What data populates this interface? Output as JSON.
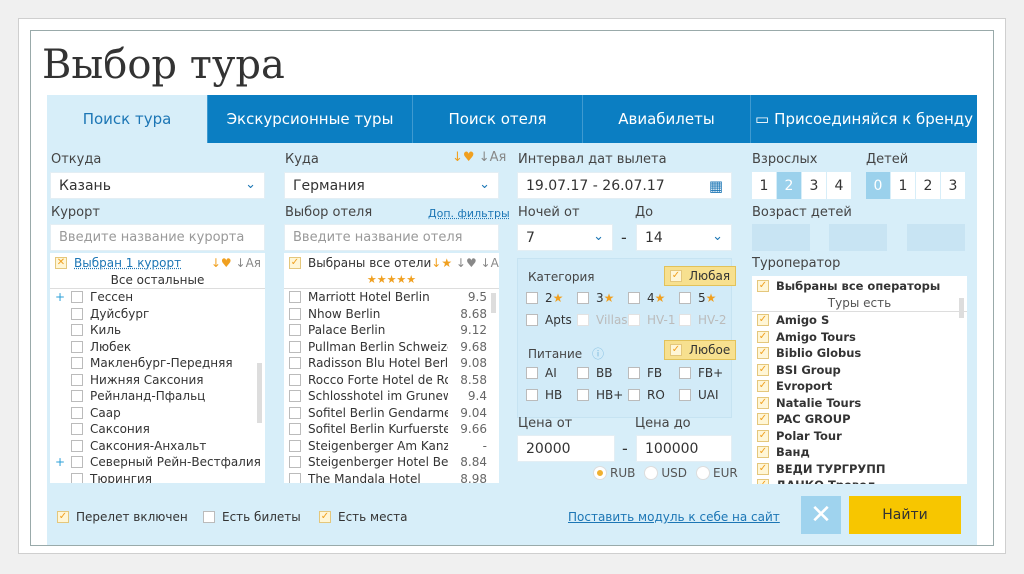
{
  "title": "Выбор тура",
  "tabs": [
    "Поиск тура",
    "Экскурсионные туры",
    "Поиск отеля",
    "Авиабилеты",
    "Присоединяйся к бренду"
  ],
  "from": {
    "label": "Откуда",
    "value": "Казань"
  },
  "to": {
    "label": "Куда",
    "value": "Германия"
  },
  "resort": {
    "label": "Курорт",
    "placeholder": "Введите название курорта",
    "selected": "Выбран 1 курорт",
    "group": "Все остальные",
    "items": [
      {
        "name": "Гессен",
        "expand": true
      },
      {
        "name": "Дуйсбург"
      },
      {
        "name": "Киль"
      },
      {
        "name": "Любек"
      },
      {
        "name": "Макленбург-Передняя"
      },
      {
        "name": "Нижняя Саксония"
      },
      {
        "name": "Рейнланд-Пфальц"
      },
      {
        "name": "Саар"
      },
      {
        "name": "Саксония"
      },
      {
        "name": "Саксония-Анхальт"
      },
      {
        "name": "Северный Рейн-Вестфалия",
        "expand": true
      },
      {
        "name": "Тюрингия"
      }
    ]
  },
  "sort_alpha": "↓Ая",
  "hotel": {
    "label": "Выбор отеля",
    "filters_link": "Доп. фильтры",
    "placeholder": "Введите название отеля",
    "selected": "Выбраны все отели",
    "stars": "★★★★★",
    "items": [
      {
        "name": "Marriott Hotel Berlin",
        "rating": "9.5"
      },
      {
        "name": "Nhow Berlin",
        "rating": "8.68"
      },
      {
        "name": "Palace Berlin",
        "rating": "9.12"
      },
      {
        "name": "Pullman Berlin Schweizerh",
        "rating": "9.68"
      },
      {
        "name": "Radisson Blu Hotel Berlin",
        "rating": "9.08"
      },
      {
        "name": "Rocco Forte Hotel de Rome",
        "rating": "8.58"
      },
      {
        "name": "Schlosshotel im Grunewald",
        "rating": "9.4"
      },
      {
        "name": "Sofitel Berlin Gendarmenm",
        "rating": "9.04"
      },
      {
        "name": "Sofitel Berlin Kurfuerstend",
        "rating": "9.66"
      },
      {
        "name": "Steigenberger Am Kanzlera",
        "rating": "-"
      },
      {
        "name": "Steigenberger Hotel Berlin",
        "rating": "8.84"
      },
      {
        "name": "The Mandala Hotel",
        "rating": "8.98"
      }
    ]
  },
  "dates": {
    "label": "Интервал дат вылета",
    "value": "19.07.17 - 26.07.17"
  },
  "nights": {
    "from_label": "Ночей от",
    "to_label": "До",
    "from": "7",
    "to": "14"
  },
  "adults": {
    "label": "Взрослых",
    "options": [
      "1",
      "2",
      "3",
      "4"
    ],
    "selected": "2"
  },
  "children": {
    "label": "Детей",
    "options": [
      "0",
      "1",
      "2",
      "3"
    ],
    "selected": "0",
    "ages_label": "Возраст детей"
  },
  "category": {
    "label": "Категория",
    "any": "Любая",
    "options": [
      "2",
      "3",
      "4",
      "5"
    ],
    "extra": [
      "Apts",
      "Villas",
      "HV-1",
      "HV-2"
    ]
  },
  "meal": {
    "label": "Питание",
    "any": "Любое",
    "options": [
      "AI",
      "BB",
      "FB",
      "FB+",
      "HB",
      "HB+",
      "RO",
      "UAI"
    ]
  },
  "price": {
    "from_label": "Цена от",
    "to_label": "Цена до",
    "from": "20000",
    "to": "100000",
    "currencies": [
      "RUB",
      "USD",
      "EUR"
    ],
    "selected": "RUB"
  },
  "operators": {
    "label": "Туроператор",
    "selected": "Выбраны все операторы",
    "group": "Туры есть",
    "items": [
      "Amigo S",
      "Amigo Tours",
      "Biblio Globus",
      "BSI Group",
      "Evroport",
      "Natalie Tours",
      "PAC GROUP",
      "Polar Tour",
      "Ванд",
      "ВЕДИ ТУРГРУПП",
      "ДАНКО Тревел"
    ]
  },
  "footer": {
    "flight": "Перелет включен",
    "tickets": "Есть билеты",
    "seats": "Есть места",
    "embed_link": "Поставить модуль к себе на сайт",
    "search": "Найти"
  },
  "colors": {
    "tab_bar": "#0b7ec2",
    "panel": "#d7eef9",
    "search_button": "#f7c600",
    "accent": "#f0a020"
  }
}
